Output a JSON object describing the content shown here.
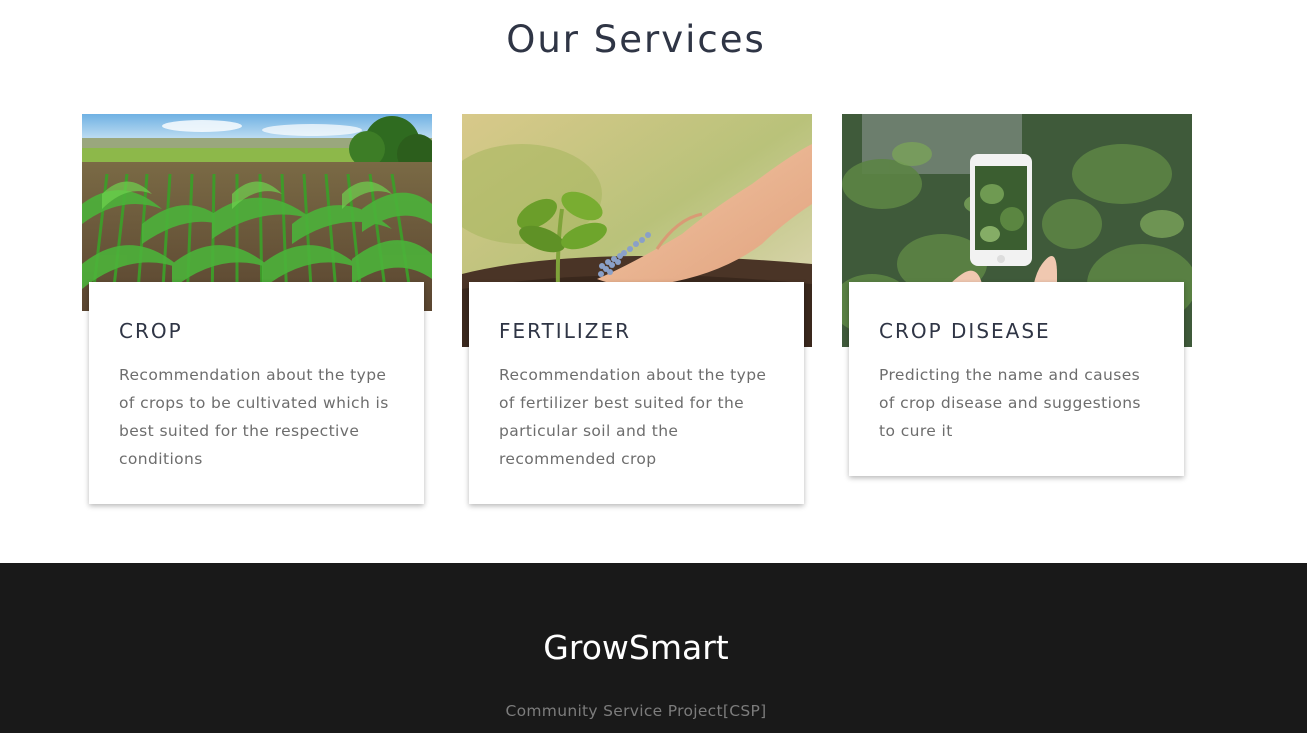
{
  "services": {
    "heading": "Our Services",
    "cards": [
      {
        "title": "CROP",
        "description": "Recommendation about the type of crops to be cultivated which is best suited for the respective conditions",
        "image": "cornfield-photo"
      },
      {
        "title": "FERTILIZER",
        "description": "Recommendation about the type of fertilizer best suited for the particular soil and the recommended crop",
        "image": "hand-fertilizer-seedling-photo"
      },
      {
        "title": "CROP DISEASE",
        "description": "Predicting the name and causes of crop disease and suggestions to cure it",
        "image": "phone-scanning-plant-photo"
      }
    ]
  },
  "footer": {
    "brand": "GrowSmart",
    "tagline": "Community Service Project[CSP]"
  },
  "colors": {
    "heading": "#2f3545",
    "body_text": "#6d6d6d",
    "footer_bg": "#191919",
    "footer_tagline": "#7c7c7c"
  }
}
